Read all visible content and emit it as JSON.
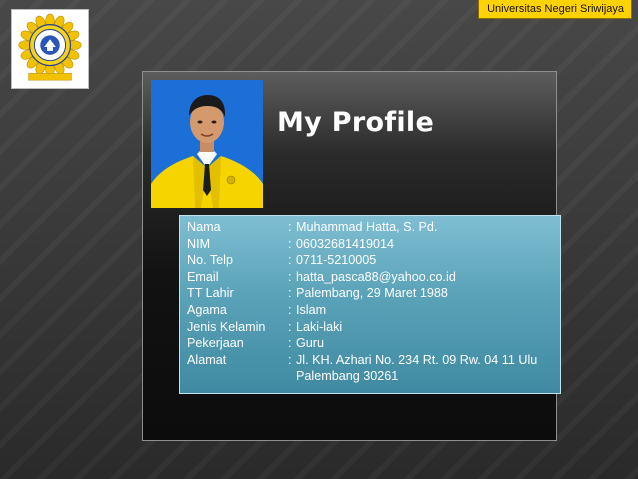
{
  "header": {
    "badge_text": "Universitas Negeri Sriwijaya",
    "logo_icon": "university-seal-icon"
  },
  "profile": {
    "title": "My Profile",
    "photo_icon": "profile-photo",
    "separator": ":",
    "fields": [
      {
        "label": "Nama",
        "value": "Muhammad Hatta, S. Pd."
      },
      {
        "label": "NIM",
        "value": "06032681419014"
      },
      {
        "label": "No. Telp",
        "value": "0711-5210005"
      },
      {
        "label": "Email",
        "value": "hatta_pasca88@yahoo.co.id"
      },
      {
        "label": "TT Lahir",
        "value": "Palembang, 29 Maret 1988"
      },
      {
        "label": "Agama",
        "value": "Islam"
      },
      {
        "label": "Jenis Kelamin",
        "value": "Laki-laki"
      },
      {
        "label": "Pekerjaan",
        "value": "Guru"
      },
      {
        "label": "Alamat",
        "value": "Jl. KH. Azhari No. 234 Rt. 09 Rw. 04 11 Ulu Palembang 30261"
      }
    ]
  },
  "colors": {
    "badge": "#ffd200",
    "info_box": "#5aa2b8",
    "photo_bg": "#1b6fd6",
    "jacket": "#f5d400"
  }
}
